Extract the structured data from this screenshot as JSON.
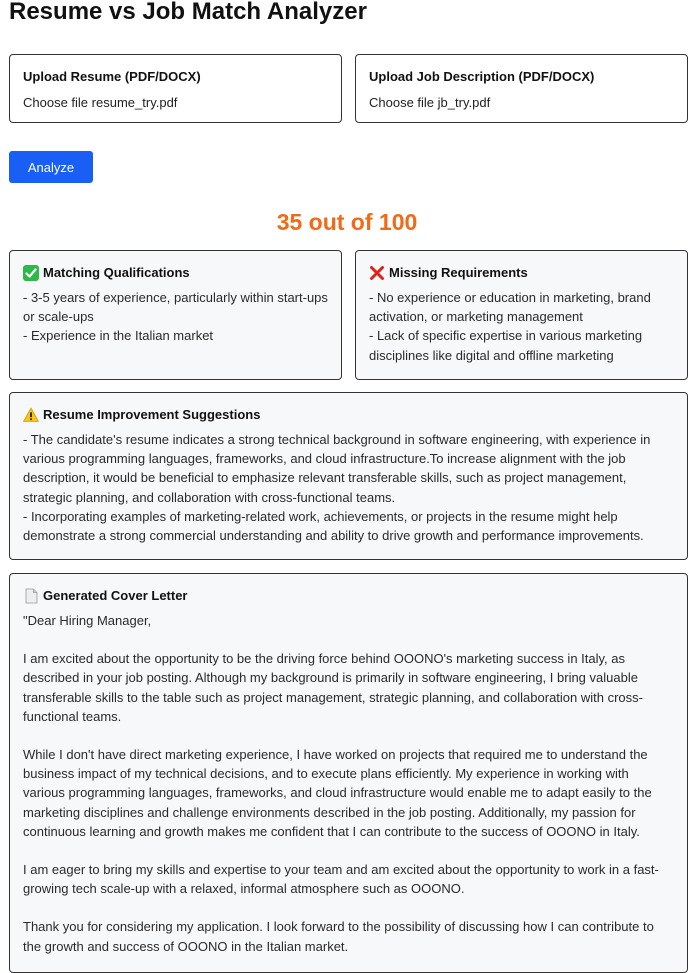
{
  "title": "Resume vs Job Match Analyzer",
  "uploads": {
    "resume": {
      "label": "Upload Resume (PDF/DOCX)",
      "choose": "Choose file",
      "filename": "resume_try.pdf"
    },
    "jd": {
      "label": "Upload Job Description (PDF/DOCX)",
      "choose": "Choose file",
      "filename": "jb_try.pdf"
    }
  },
  "analyze_label": "Analyze",
  "score_text": "35 out of 100",
  "colors": {
    "accent": "#1a5ff5",
    "score": "#f26a16",
    "check": "#2fb84a",
    "cross": "#e0201b",
    "warning": "#f5c518"
  },
  "matching": {
    "icon": "check-mark-icon",
    "title": "Matching Qualifications",
    "items": [
      "- 3-5 years of experience, particularly within start-ups or scale-ups",
      "- Experience in the Italian market"
    ]
  },
  "missing": {
    "icon": "cross-mark-icon",
    "title": "Missing Requirements",
    "items": [
      "- No experience or education in marketing, brand activation, or marketing management",
      "- Lack of specific expertise in various marketing disciplines like digital and offline marketing"
    ]
  },
  "suggestions": {
    "icon": "warning-icon",
    "title": "Resume Improvement Suggestions",
    "items": [
      "- The candidate's resume indicates a strong technical background in software engineering, with experience in various programming languages, frameworks, and cloud infrastructure.To increase alignment with the job description, it would be beneficial to emphasize relevant transferable skills, such as project management, strategic planning, and collaboration with cross-functional teams.",
      "- Incorporating examples of marketing-related work, achievements, or projects in the resume might help demonstrate a strong commercial understanding and ability to drive growth and performance improvements."
    ]
  },
  "cover_letter": {
    "icon": "document-icon",
    "title": "Generated Cover Letter",
    "paragraphs": [
      "\"Dear Hiring Manager,",
      "I am excited about the opportunity to be the driving force behind OOONO's marketing success in Italy, as described in your job posting. Although my background is primarily in software engineering, I bring valuable transferable skills to the table such as project management, strategic planning, and collaboration with cross-functional teams.",
      "While I don't have direct marketing experience, I have worked on projects that required me to understand the business impact of my technical decisions, and to execute plans efficiently. My experience in working with various programming languages, frameworks, and cloud infrastructure would enable me to adapt easily to the marketing disciplines and challenge environments described in the job posting. Additionally, my passion for continuous learning and growth makes me confident that I can contribute to the success of OOONO in Italy.",
      "I am eager to bring my skills and expertise to your team and am excited about the opportunity to work in a fast-growing tech scale-up with a relaxed, informal atmosphere such as OOONO.",
      "Thank you for considering my application. I look forward to the possibility of discussing how I can contribute to the growth and success of OOONO in the Italian market."
    ]
  }
}
